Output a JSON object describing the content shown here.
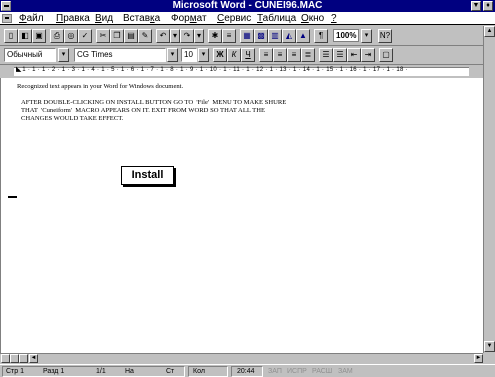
{
  "window": {
    "title": "Microsoft Word - CUNEI96.MAC",
    "minimize_icon": "down-arrow",
    "restore_icon": "up-down-arrows"
  },
  "menu": {
    "items": [
      "Файл",
      "Правка",
      "Вид",
      "Вставка",
      "Формат",
      "Сервис",
      "Таблица",
      "Окно",
      "?"
    ],
    "underlined": [
      "Ф",
      "П",
      "В",
      "к",
      "м",
      "С",
      "Т",
      "О",
      "?"
    ]
  },
  "toolbar_standard": {
    "zoom": "100%",
    "help_label": "N?"
  },
  "toolbar_format": {
    "style": "Обычный",
    "font": "CG Times",
    "size": "10",
    "bold_label": "Ж",
    "italic_label": "К",
    "underline_label": "Ч"
  },
  "ruler": {
    "ticks": "· 1 · 1 · 1 · 2 · 1 · 3 · 1 · 4 · 1 · 5 · 1 · 6 · 1 · 7 · 1 · 8 · 1 · 9 · 1 · 10 · 1 · 11 · 1 · 12 · 1 · 13 · 1 · 14 · 1 · 15 · 1 · 16 · 1 · 17 · 1 · 18 ·"
  },
  "document": {
    "line1": "Recognized text appears in your Word for Windows document.",
    "para_line1": "AFTER DOUBLE-CLICKING ON INSTALL BUTTON GO TO  'File'  MENU TO MAKE SHURE",
    "para_line2": "THAT  'Cuneiform'  MACRO APPEARS ON IT. EXIT FROM WORD SO THAT ALL THE",
    "para_line3": "CHANGES WOULD TAKE EFFECT.",
    "install_button": "Install"
  },
  "status": {
    "page": "Стр  1",
    "section": "Разд  1",
    "pages": "1/1",
    "at": "На",
    "line": "Ст",
    "col": "Кол",
    "time": "20:44",
    "rec": "ЗАП",
    "trk": "ИСПР",
    "ext": "РАСШ",
    "ovr": "ЗАМ"
  }
}
